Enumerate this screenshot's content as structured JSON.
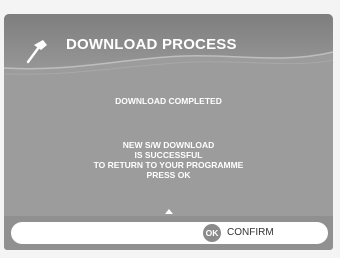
{
  "dialog": {
    "title": "DOWNLOAD PROCESS",
    "icon": "hammer-icon",
    "status": "DOWNLOAD COMPLETED",
    "message_lines": [
      "NEW S/W DOWNLOAD",
      "IS SUCCESSFUL",
      "TO RETURN TO YOUR PROGRAMME",
      "PRESS OK"
    ]
  },
  "footer": {
    "ok_label": "OK",
    "confirm_label": "CONFIRM"
  },
  "colors": {
    "panel": "#9a9a9a",
    "header": "#8a8a8a",
    "text": "#ffffff",
    "bar": "#909090"
  }
}
